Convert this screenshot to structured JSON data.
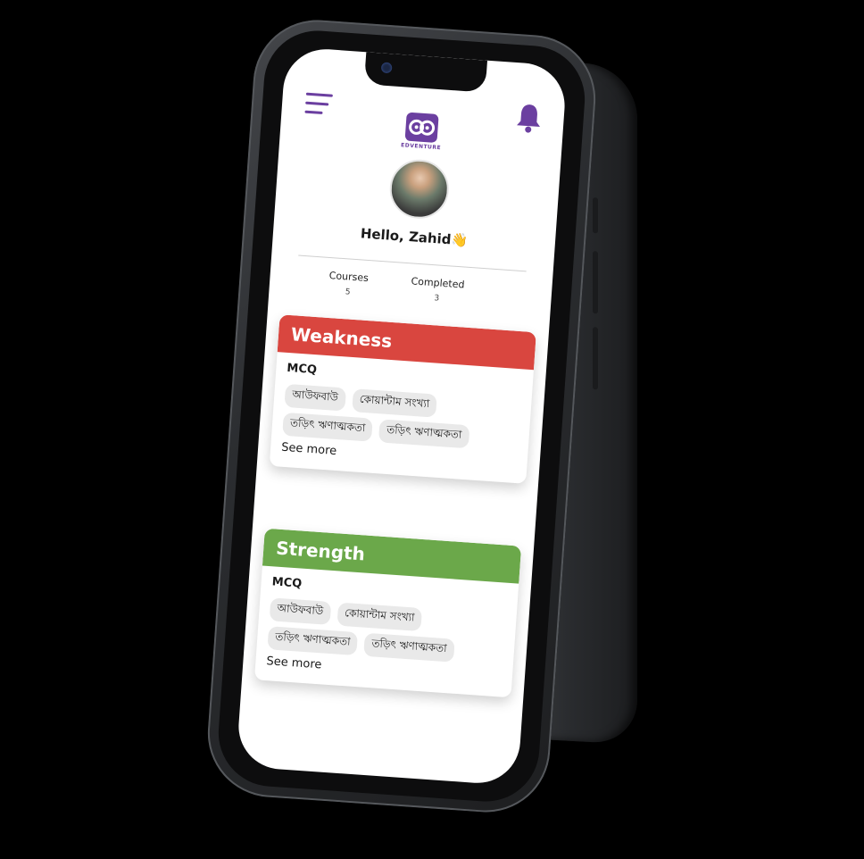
{
  "header": {
    "menu_icon": "hamburger-menu-icon",
    "notification_icon": "bell-icon",
    "logo_text": "EDVENTURE",
    "brand_color": "#6b3fa0"
  },
  "profile": {
    "greeting": "Hello, Zahid👋"
  },
  "stats": {
    "courses_label": "Courses",
    "courses_value": "5",
    "completed_label": "Completed",
    "completed_value": "3"
  },
  "weakness": {
    "title": "Weakness",
    "color": "#d9463f",
    "section": "MCQ",
    "tags": [
      "আউফবাউ",
      "কোয়ান্টাম সংখ্যা",
      "তড়িৎ ঋণাত্মকতা",
      "তড়িৎ ঋণাত্মকতা"
    ],
    "see_more": "See more"
  },
  "strength": {
    "title": "Strength",
    "color": "#6ba84a",
    "section": "MCQ",
    "tags": [
      "আউফবাউ",
      "কোয়ান্টাম সংখ্যা",
      "তড়িৎ ঋণাত্মকতা",
      "তড়িৎ ঋণাত্মকতা"
    ],
    "see_more": "See more"
  }
}
